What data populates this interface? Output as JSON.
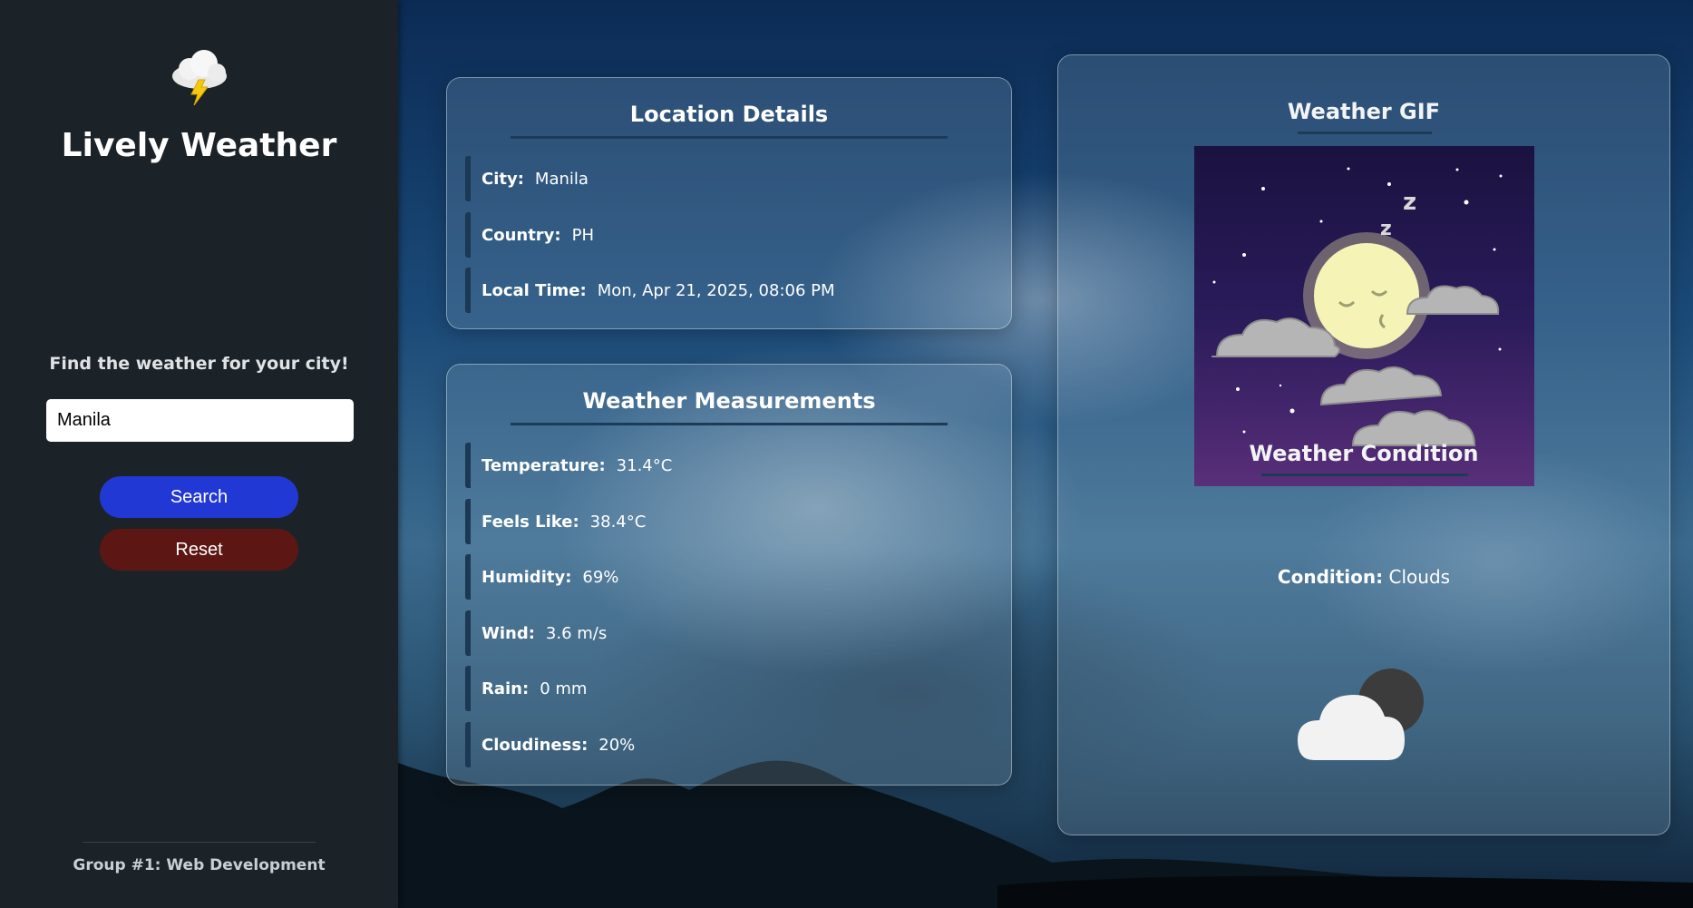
{
  "sidebar": {
    "logo_icon": "thunderstorm-cloud-icon",
    "title": "Lively Weather",
    "prompt": "Find the weather for your city!",
    "search_input_value": "Manila",
    "search_button": "Search",
    "reset_button": "Reset",
    "footer": "Group #1: Web Development"
  },
  "location": {
    "heading": "Location Details",
    "city_label": "City:",
    "city_value": "Manila",
    "country_label": "Country:",
    "country_value": "PH",
    "time_label": "Local Time:",
    "time_value": "Mon, Apr 21, 2025, 08:06 PM"
  },
  "measurements": {
    "heading": "Weather Measurements",
    "temperature_label": "Temperature:",
    "temperature_value": "31.4°C",
    "feels_label": "Feels Like:",
    "feels_value": "38.4°C",
    "humidity_label": "Humidity:",
    "humidity_value": "69%",
    "wind_label": "Wind:",
    "wind_value": "3.6 m/s",
    "rain_label": "Rain:",
    "rain_value": "0 mm",
    "cloudiness_label": "Cloudiness:",
    "cloudiness_value": "20%"
  },
  "right_panel": {
    "gif_heading": "Weather GIF",
    "gif_image": "sleeping-moon-clouds-gif",
    "condition_heading": "Weather Condition",
    "condition_label": "Condition:",
    "condition_value": "Clouds",
    "condition_icon": "cloudy-night-icon"
  },
  "colors": {
    "sidebar_bg": "#1c2328",
    "search_button": "#2238d4",
    "reset_button": "#5c1714",
    "accent_bar": "#1b3854"
  }
}
